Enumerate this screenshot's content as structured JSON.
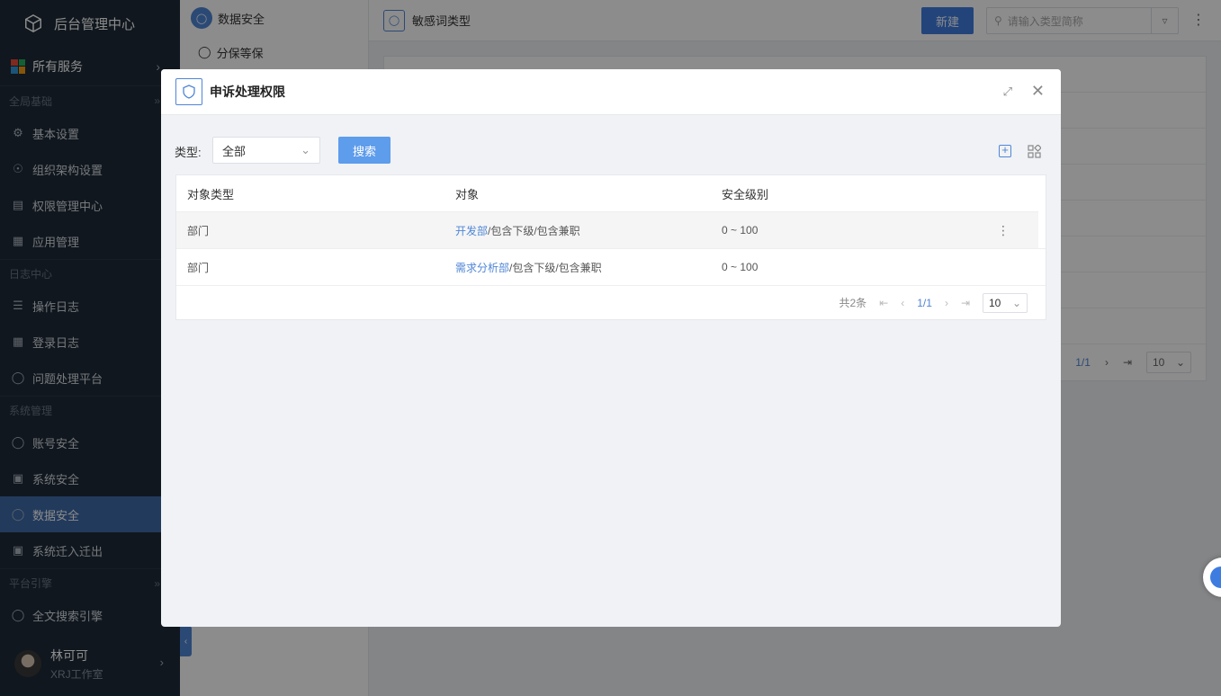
{
  "sidebar": {
    "app_title": "后台管理中心",
    "all_services": "所有服务",
    "groups": [
      {
        "label": "全局基础",
        "items": [
          "基本设置",
          "组织架构设置",
          "权限管理中心",
          "应用管理"
        ]
      },
      {
        "label": "日志中心",
        "items": [
          "操作日志",
          "登录日志",
          "问题处理平台"
        ]
      },
      {
        "label": "系统管理",
        "items": [
          "账号安全",
          "系统安全",
          "数据安全",
          "系统迁入迁出"
        ]
      },
      {
        "label": "平台引擎",
        "items": [
          "全文搜索引擎"
        ]
      }
    ],
    "active_item": "数据安全",
    "user": {
      "name": "林可可",
      "org": "XRJ工作室"
    }
  },
  "subnav": {
    "title": "数据安全",
    "items": [
      "分保等保"
    ]
  },
  "main": {
    "title": "敏感词类型",
    "new_button": "新建",
    "search_placeholder": "请输入类型简称",
    "pager": {
      "page": "1/1",
      "size": "10"
    }
  },
  "modal": {
    "title": "申诉处理权限",
    "filter_label": "类型:",
    "type_value": "全部",
    "search_button": "搜索",
    "table": {
      "headers": [
        "对象类型",
        "对象",
        "安全级别"
      ],
      "rows": [
        {
          "type": "部门",
          "object_link": "开发部",
          "object_suffix": "/包含下级/包含兼职",
          "level": "0 ~ 100"
        },
        {
          "type": "部门",
          "object_link": "需求分析部",
          "object_suffix": "/包含下级/包含兼职",
          "level": "0 ~ 100"
        }
      ]
    },
    "footer": {
      "total": "共2条",
      "page": "1/1",
      "size": "10"
    }
  },
  "colors": {
    "sidebar_bg": "#1e2a38",
    "active": "#3e6aa8",
    "primary": "#3e7ce0",
    "link": "#4f86d6"
  }
}
